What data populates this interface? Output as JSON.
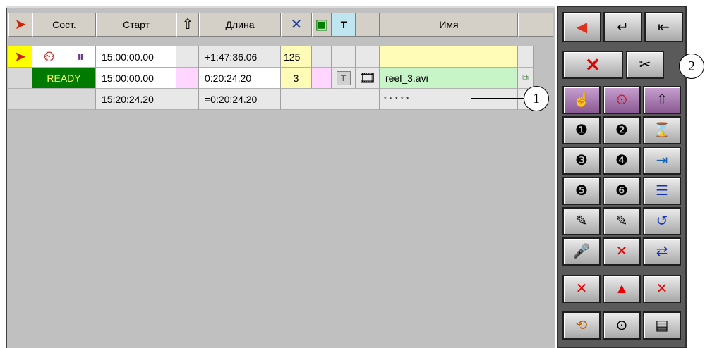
{
  "columns": {
    "state": "Сост.",
    "start": "Старт",
    "length": "Длина",
    "t": "T",
    "name": "Имя"
  },
  "rows": [
    {
      "start": "15:00:00.00",
      "length": "+1:47:36.06",
      "count": "125",
      "name": ""
    },
    {
      "state": "READY",
      "start": "15:00:00.00",
      "length": "0:20:24.20",
      "count": "3",
      "t": "T",
      "name": "reel_3.avi"
    },
    {
      "start": "15:20:24.20",
      "length": "=0:20:24.20",
      "name": "* * * * *"
    }
  ],
  "callouts": {
    "one": "1",
    "two": "2"
  },
  "icons": {
    "top_row": [
      "arrow-left-icon",
      "enter-icon",
      "skip-back-icon"
    ],
    "second_row": [
      "delete-icon",
      "cut-icon"
    ],
    "grid": [
      [
        "hand-icon",
        "clock-icon",
        "arrow-up-icon"
      ],
      [
        "camera-1-icon",
        "camera-2-icon",
        "hourglass-icon"
      ],
      [
        "camera-3-icon",
        "camera-4-icon",
        "insert-icon"
      ],
      [
        "camera-5-icon",
        "camera-6-icon",
        "list-icon"
      ],
      [
        "pen-1-icon",
        "pen-2-icon",
        "list-return-icon"
      ],
      [
        "mic-icon",
        "mic-off-icon",
        "list-jump-icon"
      ],
      [
        "page-delete-icon",
        "page-up-icon",
        "page-remove-icon"
      ],
      [
        "refresh-icon",
        "info-icon",
        "save-icon"
      ]
    ]
  },
  "colors": {
    "ready_bg": "#007a00",
    "ready_fg": "#ffff66",
    "name_bg_yellow": "#fffcb8",
    "name_bg_green": "#c8f5c8",
    "pink": "#ffd6ff"
  }
}
